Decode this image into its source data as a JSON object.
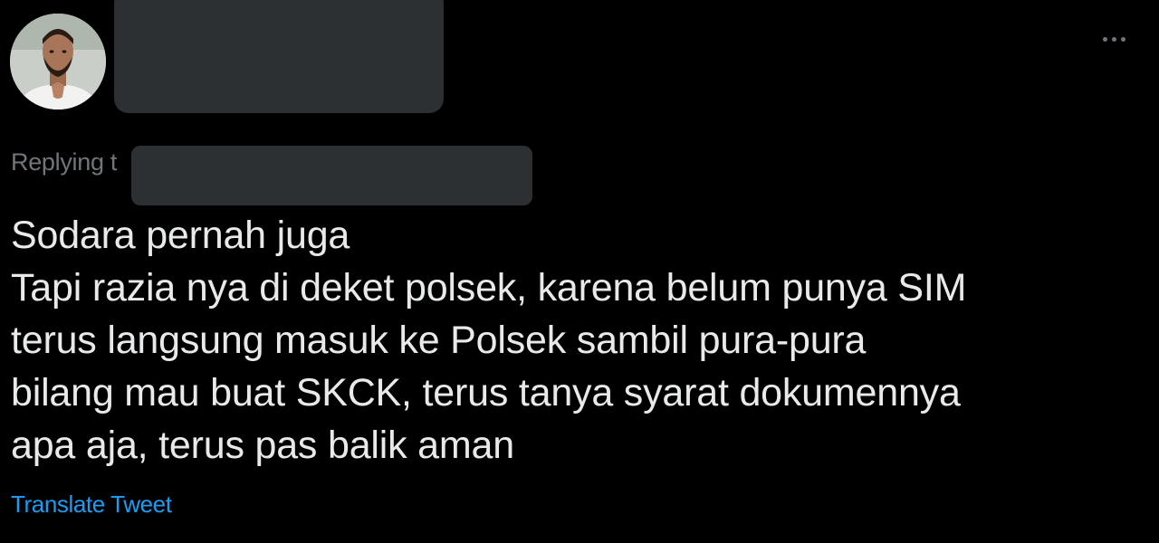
{
  "tweet": {
    "avatar_icon": "user-avatar-photo",
    "more_icon": "more-horizontal-icon",
    "replying_label": "Replying t",
    "text_lines": [
      "Sodara pernah juga",
      "Tapi razia nya di deket polsek, karena belum punya SIM",
      "terus langsung masuk ke Polsek sambil pura-pura",
      "bilang mau buat SKCK, terus tanya syarat dokumennya",
      "apa aja, terus pas balik aman"
    ],
    "translate_label": "Translate Tweet"
  },
  "colors": {
    "background": "#000000",
    "text": "#e7e9ea",
    "muted": "#71767b",
    "link": "#1d9bf0",
    "redaction": "#2d3033"
  }
}
